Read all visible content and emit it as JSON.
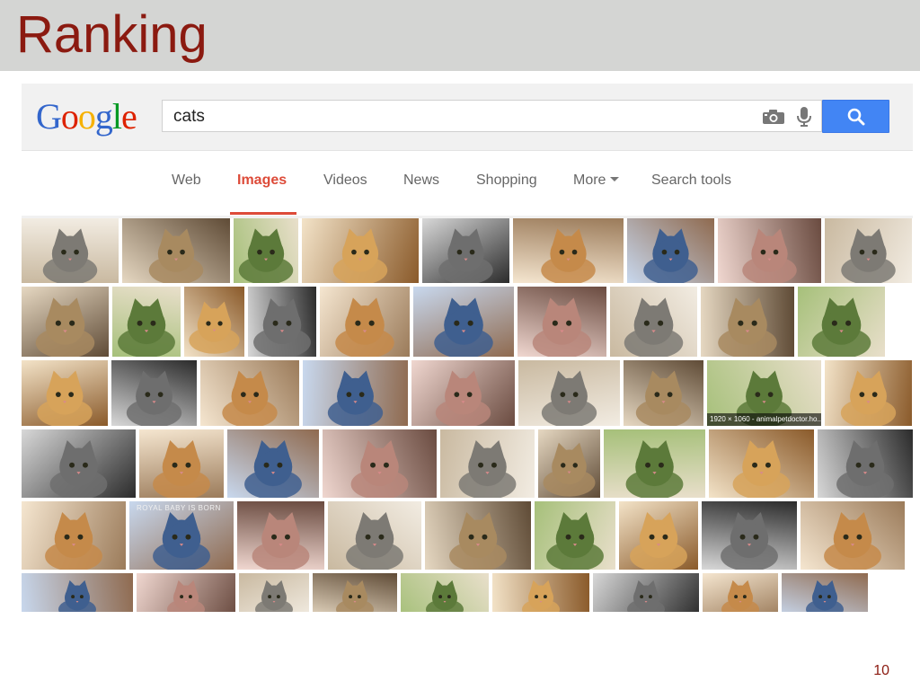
{
  "slide": {
    "title": "Ranking",
    "page_number": "10"
  },
  "google": {
    "logo_letters": [
      {
        "char": "G",
        "color": "#3366cc"
      },
      {
        "char": "o",
        "color": "#dd2200"
      },
      {
        "char": "o",
        "color": "#f6b100"
      },
      {
        "char": "g",
        "color": "#3366cc"
      },
      {
        "char": "l",
        "color": "#009922"
      },
      {
        "char": "e",
        "color": "#dd2200"
      }
    ],
    "search": {
      "query": "cats",
      "camera_icon": "camera-icon",
      "mic_icon": "microphone-icon",
      "button_icon": "magnifier-icon",
      "button_color": "#4285f4"
    },
    "tabs": [
      {
        "label": "Web",
        "active": false
      },
      {
        "label": "Images",
        "active": true
      },
      {
        "label": "Videos",
        "active": false
      },
      {
        "label": "News",
        "active": false
      },
      {
        "label": "Shopping",
        "active": false
      },
      {
        "label": "More",
        "active": false
      },
      {
        "label": "Search tools",
        "active": false
      }
    ],
    "accent_color": "#dd4b39"
  },
  "results": {
    "image_caption": "1920 × 1060 - animalpetdoctor.ho...",
    "image_overlay_text": "ROYAL BABY IS BORN"
  }
}
